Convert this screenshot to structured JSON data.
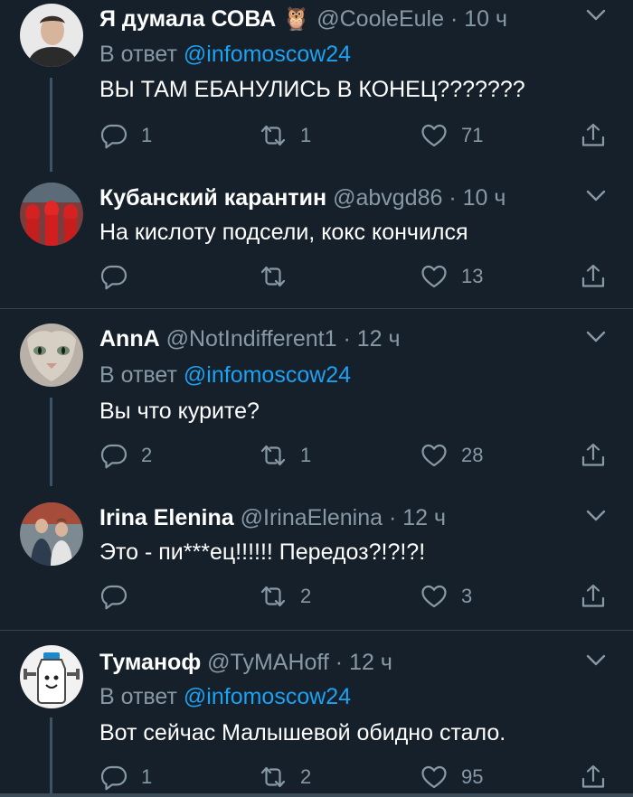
{
  "tweets": [
    {
      "name": "Я думала СОВА",
      "emoji": "🦉",
      "handle": "@CooleEule",
      "time": "10 ч",
      "reply_prefix": "В ответ",
      "reply_to": "@infomoscow24",
      "text": "ВЫ ТАМ ЕБАНУЛИСЬ В КОНЕЦ???????",
      "replies": "1",
      "retweets": "1",
      "likes": "71"
    },
    {
      "name": "Кубанский карантин",
      "handle": "@abvgd86",
      "time": "10 ч",
      "text": "На кислоту подсели, кокс кончился",
      "replies": "",
      "retweets": "",
      "likes": "13"
    },
    {
      "name": "AnnA",
      "handle": "@NotIndifferent1",
      "time": "12 ч",
      "reply_prefix": "В ответ",
      "reply_to": "@infomoscow24",
      "text": "Вы что курите?",
      "replies": "2",
      "retweets": "1",
      "likes": "28"
    },
    {
      "name": "Irina Elenina",
      "handle": "@IrinaElenina",
      "time": "12 ч",
      "text": "Это - пи***ец!!!!!! Передоз?!?!?!",
      "replies": "",
      "retweets": "2",
      "likes": "3"
    },
    {
      "name": "Туманоф",
      "handle": "@TyMAHoff",
      "time": "12 ч",
      "reply_prefix": "В ответ",
      "reply_to": "@infomoscow24",
      "text": "Вот сейчас Малышевой обидно стало.",
      "replies": "1",
      "retweets": "2",
      "likes": "95"
    }
  ],
  "separator": "·",
  "icons": [
    "reply-icon",
    "retweet-icon",
    "like-icon",
    "share-icon",
    "chevron-down-icon"
  ],
  "colors": {
    "background": "#15202b",
    "link": "#1da1f2",
    "muted": "#8899a6",
    "emoji": "#e0691b"
  }
}
